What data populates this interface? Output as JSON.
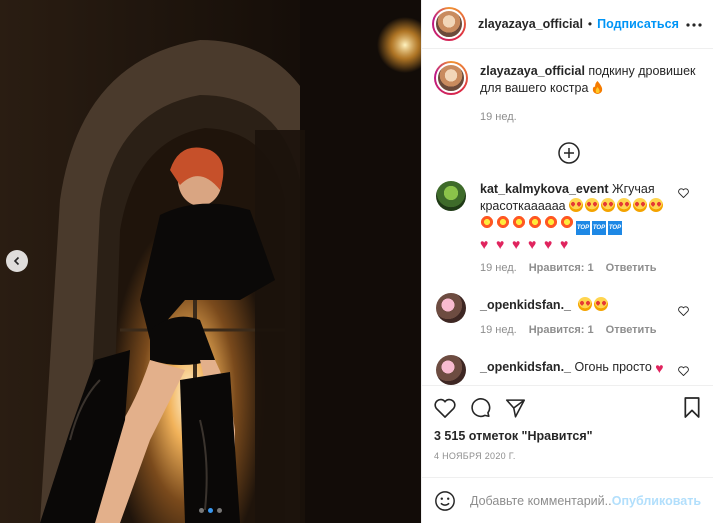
{
  "post": {
    "username": "zlayazaya_official",
    "header_sep": "•",
    "follow_label": "Подписаться",
    "more_icon": "more-dots-icon",
    "caption_user": "zlayazaya_official",
    "caption_text": "подкину дровишек для вашего костра",
    "caption_emoji": "fire-icon",
    "caption_time": "19 нед.",
    "load_more_icon": "plus-circle-icon"
  },
  "comments": [
    {
      "user": "kat_kalmykova_event",
      "text": "Жгучая красоткаааааа",
      "emojis": "heart-eyes x6, collision x6, top x3, red-heart x6",
      "time": "19 нед.",
      "likes": "Нравится: 1",
      "reply": "Ответить"
    },
    {
      "user": "_openkidsfan._",
      "text": "",
      "emojis": "heart-eyes x2",
      "time": "19 нед.",
      "likes": "Нравится: 1",
      "reply": "Ответить"
    },
    {
      "user": "_openkidsfan._",
      "text": "Огонь просто",
      "emojis": "red-heart x1"
    }
  ],
  "actions": {
    "like_icon": "heart-outline-icon",
    "comment_icon": "comment-bubble-icon",
    "share_icon": "paper-plane-icon",
    "save_icon": "bookmark-icon",
    "likes_text": "3 515 отметок \"Нравится\"",
    "date_text": "4 НОЯБРЯ 2020 Г."
  },
  "add_comment": {
    "emoji_icon": "smiley-icon",
    "placeholder": "Добавьте комментарий...",
    "post_label": "Опубликовать"
  },
  "photo": {
    "prev_icon": "chevron-left-icon",
    "slide_count": 3,
    "active_slide": 2
  },
  "colors": {
    "accent": "#0095f6",
    "muted": "#8e8e8e",
    "post_disabled": "#b2dffc"
  }
}
